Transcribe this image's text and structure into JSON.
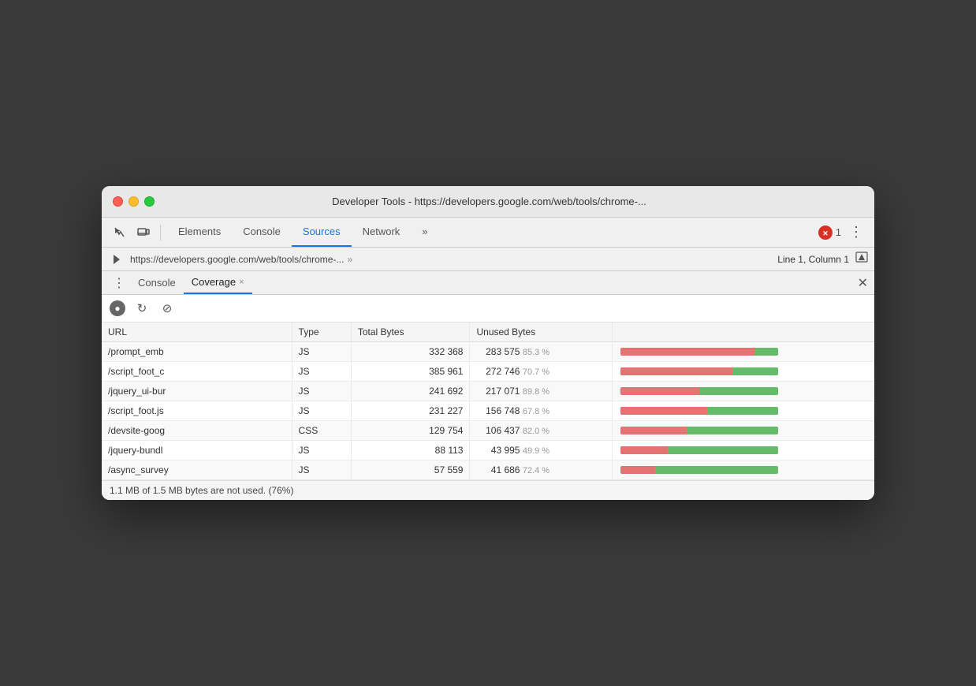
{
  "window": {
    "title": "Developer Tools - https://developers.google.com/web/tools/chrome-..."
  },
  "traffic_lights": {
    "close": "close",
    "minimize": "minimize",
    "maximize": "maximize"
  },
  "toolbar": {
    "inspect_icon": "⬡",
    "device_icon": "▣",
    "tabs": [
      "Elements",
      "Console",
      "Sources",
      "Network",
      "»"
    ],
    "active_tab": "Sources",
    "error_count": "1",
    "more_icon": "⋮"
  },
  "secondary": {
    "play_icon": "▶",
    "breadcrumb": "https://developers.google.com/web/tools/chrome-...",
    "breadcrumb_dots": "»",
    "line_col": "Line 1, Column 1",
    "format_icon": "▲"
  },
  "drawer": {
    "menu_icon": "⋮",
    "tabs": [
      {
        "label": "Console",
        "active": false
      },
      {
        "label": "Coverage",
        "active": true,
        "closeable": true
      }
    ],
    "close_label": "✕"
  },
  "coverage": {
    "record_icon": "●",
    "refresh_icon": "↻",
    "clear_icon": "⊘",
    "table": {
      "headers": [
        "URL",
        "Type",
        "Total Bytes",
        "Unused Bytes",
        ""
      ],
      "rows": [
        {
          "url": "/prompt_emb",
          "type": "JS",
          "total_bytes": "332 368",
          "unused_bytes": "283 575",
          "unused_pct": "85.3 %",
          "bar_red_pct": 85,
          "bar_green_pct": 15
        },
        {
          "url": "/script_foot_c",
          "type": "JS",
          "total_bytes": "385 961",
          "unused_bytes": "272 746",
          "unused_pct": "70.7 %",
          "bar_red_pct": 71,
          "bar_green_pct": 29
        },
        {
          "url": "/jquery_ui-bur",
          "type": "JS",
          "total_bytes": "241 692",
          "unused_bytes": "217 071",
          "unused_pct": "89.8 %",
          "bar_red_pct": 50,
          "bar_green_pct": 50
        },
        {
          "url": "/script_foot.js",
          "type": "JS",
          "total_bytes": "231 227",
          "unused_bytes": "156 748",
          "unused_pct": "67.8 %",
          "bar_red_pct": 55,
          "bar_green_pct": 45
        },
        {
          "url": "/devsite-goog",
          "type": "CSS",
          "total_bytes": "129 754",
          "unused_bytes": "106 437",
          "unused_pct": "82.0 %",
          "bar_red_pct": 42,
          "bar_green_pct": 58
        },
        {
          "url": "/jquery-bundl",
          "type": "JS",
          "total_bytes": "88 113",
          "unused_bytes": "43 995",
          "unused_pct": "49.9 %",
          "bar_red_pct": 30,
          "bar_green_pct": 70
        },
        {
          "url": "/async_survey",
          "type": "JS",
          "total_bytes": "57 559",
          "unused_bytes": "41 686",
          "unused_pct": "72.4 %",
          "bar_red_pct": 22,
          "bar_green_pct": 78
        }
      ]
    }
  },
  "status_bar": {
    "text": "1.1 MB of 1.5 MB bytes are not used. (76%)"
  }
}
